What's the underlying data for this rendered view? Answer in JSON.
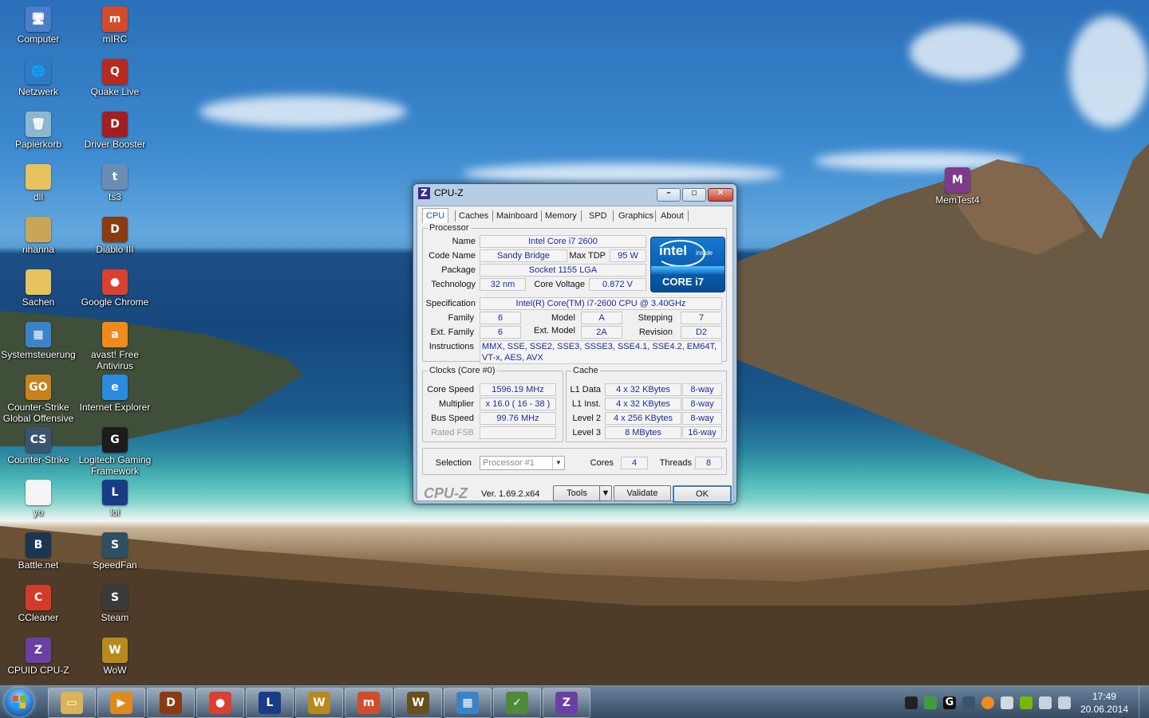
{
  "desktop": {
    "icons": [
      {
        "label": "Computer",
        "color": "#4a7fc8",
        "glyph": "🖥"
      },
      {
        "label": "mIRC",
        "color": "#d24c2b",
        "glyph": "m"
      },
      {
        "label": "Netzwerk",
        "color": "#2e7bc4",
        "glyph": "🌐"
      },
      {
        "label": "Quake Live",
        "color": "#b62a1f",
        "glyph": "Q"
      },
      {
        "label": "Papierkorb",
        "color": "#8fb6cf",
        "glyph": "🗑"
      },
      {
        "label": "Driver Booster",
        "color": "#a31f1f",
        "glyph": "D"
      },
      {
        "label": "dll",
        "color": "#e6c35c",
        "glyph": ""
      },
      {
        "label": "ts3",
        "color": "#6b8db3",
        "glyph": "t"
      },
      {
        "label": "rihanna",
        "color": "#c9a55a",
        "glyph": ""
      },
      {
        "label": "Diablo III",
        "color": "#8a3b12",
        "glyph": "D"
      },
      {
        "label": "Sachen",
        "color": "#e6c35c",
        "glyph": ""
      },
      {
        "label": "Google Chrome",
        "color": "#d9402f",
        "glyph": "●"
      },
      {
        "label": "Systemsteuerung",
        "color": "#3b83c9",
        "glyph": "▦"
      },
      {
        "label": "avast! Free\nAntivirus",
        "color": "#f08a1c",
        "glyph": "a"
      },
      {
        "label": "Counter-Strike\nGlobal Offensive",
        "color": "#c7821d",
        "glyph": "GO"
      },
      {
        "label": "Internet Explorer",
        "color": "#2a8be0",
        "glyph": "e"
      },
      {
        "label": "Counter-Strike",
        "color": "#3a5470",
        "glyph": "CS"
      },
      {
        "label": "Logitech Gaming\nFramework",
        "color": "#1c1c1c",
        "glyph": "G"
      },
      {
        "label": "yo",
        "color": "#f5f5f5",
        "glyph": ""
      },
      {
        "label": "lol",
        "color": "#1a3c86",
        "glyph": "L"
      },
      {
        "label": "Battle.net",
        "color": "#1b3552",
        "glyph": "B"
      },
      {
        "label": "SpeedFan",
        "color": "#2f4f62",
        "glyph": "S"
      },
      {
        "label": "CCleaner",
        "color": "#d23b2c",
        "glyph": "C"
      },
      {
        "label": "Steam",
        "color": "#3a3a3a",
        "glyph": "S"
      },
      {
        "label": "CPUID CPU-Z",
        "color": "#6b3fa3",
        "glyph": "Z"
      },
      {
        "label": "WoW",
        "color": "#b88a1e",
        "glyph": "W"
      },
      {
        "label": "MemTest4",
        "color": "#7d3b8c",
        "glyph": "M"
      }
    ]
  },
  "cpuz": {
    "title": "CPU-Z",
    "tabs": [
      "CPU",
      "Caches",
      "Mainboard",
      "Memory",
      "SPD",
      "Graphics",
      "About"
    ],
    "processor": {
      "legend": "Processor",
      "name_label": "Name",
      "name": "Intel Core i7 2600",
      "codename_label": "Code Name",
      "codename": "Sandy Bridge",
      "maxtdp_label": "Max TDP",
      "maxtdp": "95 W",
      "package_label": "Package",
      "package": "Socket 1155 LGA",
      "technology_label": "Technology",
      "technology": "32 nm",
      "corevoltage_label": "Core Voltage",
      "corevoltage": "0.872 V",
      "spec_label": "Specification",
      "spec": "Intel(R) Core(TM) i7-2600 CPU @ 3.40GHz",
      "family_label": "Family",
      "family": "6",
      "model_label": "Model",
      "model": "A",
      "stepping_label": "Stepping",
      "stepping": "7",
      "extfamily_label": "Ext. Family",
      "extfamily": "6",
      "extmodel_label": "Ext. Model",
      "extmodel": "2A",
      "revision_label": "Revision",
      "revision": "D2",
      "instructions_label": "Instructions",
      "instructions": "MMX, SSE, SSE2, SSE3, SSSE3, SSE4.1, SSE4.2, EM64T, VT-x, AES, AVX",
      "logo_intel": "intel",
      "logo_inside": "inside",
      "logo_core": "CORE i7"
    },
    "clocks": {
      "legend": "Clocks (Core #0)",
      "corespeed_label": "Core Speed",
      "corespeed": "1596.19 MHz",
      "multiplier_label": "Multiplier",
      "multiplier": "x 16.0 ( 16 - 38 )",
      "busspeed_label": "Bus Speed",
      "busspeed": "99.76 MHz",
      "ratedfsb_label": "Rated FSB",
      "ratedfsb": ""
    },
    "cache": {
      "legend": "Cache",
      "rows": [
        {
          "label": "L1 Data",
          "size": "4 x 32 KBytes",
          "way": "8-way"
        },
        {
          "label": "L1 Inst.",
          "size": "4 x 32 KBytes",
          "way": "8-way"
        },
        {
          "label": "Level 2",
          "size": "4 x 256 KBytes",
          "way": "8-way"
        },
        {
          "label": "Level 3",
          "size": "8 MBytes",
          "way": "16-way"
        }
      ]
    },
    "selection": {
      "label": "Selection",
      "value": "Processor #1",
      "cores_label": "Cores",
      "cores": "4",
      "threads_label": "Threads",
      "threads": "8"
    },
    "footer": {
      "brand": "CPU-Z",
      "version": "Ver. 1.69.2.x64",
      "tools": "Tools",
      "validate": "Validate",
      "ok": "OK"
    }
  },
  "taskbar": {
    "apps": [
      {
        "name": "explorer",
        "color": "#d9b45a",
        "glyph": "▭"
      },
      {
        "name": "media-player",
        "color": "#e08a1e",
        "glyph": "▶"
      },
      {
        "name": "diablo",
        "color": "#8a3b12",
        "glyph": "D"
      },
      {
        "name": "chrome",
        "color": "#d9402f",
        "glyph": "●"
      },
      {
        "name": "lol",
        "color": "#1a3c86",
        "glyph": "L"
      },
      {
        "name": "wow",
        "color": "#b88a1e",
        "glyph": "W"
      },
      {
        "name": "mirc",
        "color": "#d24c2b",
        "glyph": "m"
      },
      {
        "name": "wow-2",
        "color": "#6a4f1a",
        "glyph": "W"
      },
      {
        "name": "control-panel",
        "color": "#3b83c9",
        "glyph": "▦"
      },
      {
        "name": "task-manager",
        "color": "#4f8a3a",
        "glyph": "✓"
      },
      {
        "name": "cpu-z",
        "color": "#6b3fa3",
        "glyph": "Z"
      }
    ],
    "time": "17:49",
    "date": "20.06.2014"
  }
}
